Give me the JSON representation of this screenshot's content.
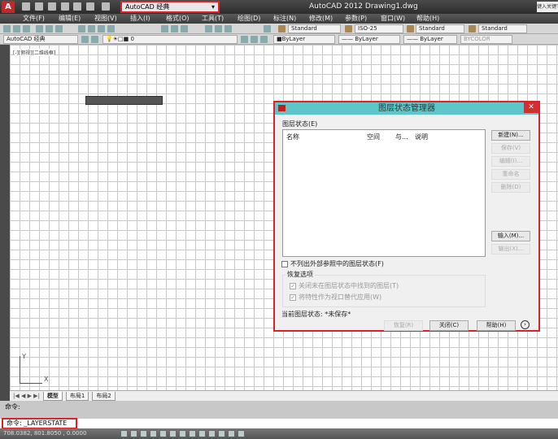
{
  "title_bar": {
    "app_title": "AutoCAD 2012    Drawing1.dwg",
    "workspace": "AutoCAD 经典",
    "search_placeholder": "键入关键字"
  },
  "menu": [
    "文件(F)",
    "编辑(E)",
    "视图(V)",
    "插入(I)",
    "格式(O)",
    "工具(T)",
    "绘图(D)",
    "标注(N)",
    "修改(M)",
    "参数(P)",
    "窗口(W)",
    "帮助(H)"
  ],
  "toolbar1": {
    "text_style": "Standard",
    "dim_style": "ISO-25",
    "table_style": "Standard",
    "multileader_style": "Standard"
  },
  "toolbar2": {
    "workspace": "AutoCAD 经典",
    "layer": "0",
    "color": "ByLayer",
    "linetype": "ByLayer",
    "lineweight": "ByLayer",
    "plotstyle": "BYCOLOR"
  },
  "viewport_label": "[-][俯视][二维线框]",
  "layout_tabs": [
    "模型",
    "布局1",
    "布局2"
  ],
  "command": {
    "history": "命令:",
    "current": "命令: _LAYERSTATE"
  },
  "status": {
    "coords": "708.0382, 801.8050 , 0.0000"
  },
  "dialog": {
    "title": "图层状态管理器",
    "section_label": "图层状态(E)",
    "columns": [
      "名称",
      "空间",
      "与...",
      "说明"
    ],
    "buttons": {
      "new": "新建(N)...",
      "save": "保存(V)",
      "edit": "编辑(I)...",
      "rename": "重命名",
      "delete": "删除(D)",
      "import": "输入(M)...",
      "export": "输出(X)..."
    },
    "xref_checkbox": {
      "label": "不列出外部参照中的图层状态(F)",
      "checked": false
    },
    "restore_options": {
      "title": "恢复选项",
      "opt1": {
        "label": "关闭未在图层状态中找到的图层(T)",
        "checked": true
      },
      "opt2": {
        "label": "将特性作为视口替代应用(W)",
        "checked": true
      }
    },
    "current_state": "当前图层状态: *未保存*",
    "footer": {
      "restore": "恢复(R)",
      "close": "关闭(C)",
      "help": "帮助(H)"
    }
  }
}
